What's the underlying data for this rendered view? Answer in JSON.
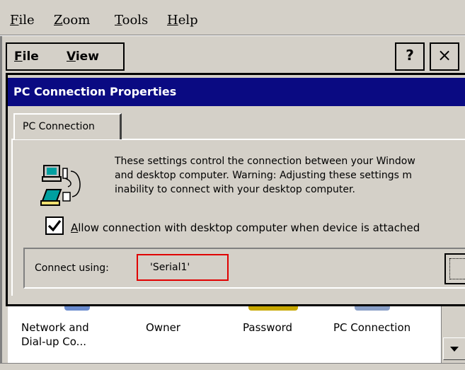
{
  "outer_menu": [
    {
      "name": "outer-menu-file",
      "first": "F",
      "rest": "ile"
    },
    {
      "name": "outer-menu-zoom",
      "first": "Z",
      "rest": "oom"
    },
    {
      "name": "outer-menu-tools",
      "first": "T",
      "rest": "ools"
    },
    {
      "name": "outer-menu-help",
      "first": "H",
      "rest": "elp"
    }
  ],
  "cmdbar": {
    "file_first": "F",
    "file_rest": "ile",
    "view_first": "V",
    "view_rest": "iew",
    "help_label": "?",
    "close_label": "×"
  },
  "dialog": {
    "title": "PC Connection Properties",
    "tab_label": "PC Connection",
    "description": [
      "These settings control the connection between your Window",
      "and desktop computer.  Warning: Adjusting these settings m",
      "inability to connect with your desktop computer."
    ],
    "allow_checked": true,
    "allow_label_first": "A",
    "allow_label_rest": "llow connection with desktop computer when device is attached",
    "connect_label": "Connect using:",
    "connect_value": "'Serial1'",
    "highlight_color": "#e00000"
  },
  "control_panel": {
    "items": [
      {
        "line1": "Network and",
        "line2": "Dial-up Co..."
      },
      {
        "line1": "Owner",
        "line2": ""
      },
      {
        "line1": "Password",
        "line2": ""
      },
      {
        "line1": "PC Connection",
        "line2": ""
      }
    ]
  },
  "colors": {
    "title_bar": "#0a0a82",
    "face": "#d4d0c8"
  },
  "icons": [
    "pc-connection-icon",
    "check-icon",
    "scroll-down-arrow-icon",
    "help-icon",
    "close-icon"
  ]
}
